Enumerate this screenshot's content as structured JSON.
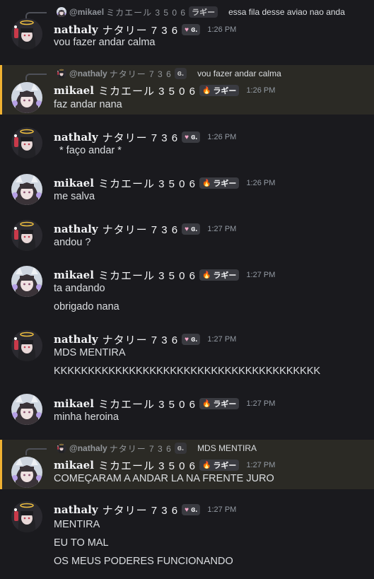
{
  "users": {
    "nathaly": {
      "name": "nathaly",
      "name_jp": "ナタリー 7 3 6",
      "tag": "ɞ.",
      "tag_icon": "♥"
    },
    "mikael": {
      "name": "mikael",
      "name_jp": "ミカエール 3 5 0 6",
      "tag": "ラギー",
      "tag_icon": "🔥"
    }
  },
  "colors": {
    "background": "#1a1a1e",
    "highlight_bg": "#2b2a25",
    "highlight_bar": "#f0b232",
    "timestamp": "#949ba4",
    "tag_bg": "#3a3b41"
  },
  "messages": [
    {
      "author": "nathaly",
      "time": "1:26 PM",
      "highlighted": false,
      "reply": {
        "author": "@mikael",
        "author_jp": "ミカエール 3 5 0 6",
        "tag": "ラギー",
        "text": "essa fila desse aviao nao anda"
      },
      "lines": [
        "vou fazer andar calma"
      ]
    },
    {
      "author": "mikael",
      "time": "1:26 PM",
      "highlighted": true,
      "reply": {
        "author": "@nathaly",
        "author_jp": "ナタリー 7 3 6",
        "tag": "ɞ.",
        "text": "vou fazer andar calma"
      },
      "lines": [
        "faz andar nana"
      ]
    },
    {
      "author": "nathaly",
      "time": "1:26 PM",
      "highlighted": false,
      "lines": [
        "  * faço andar *"
      ]
    },
    {
      "author": "mikael",
      "time": "1:26 PM",
      "highlighted": false,
      "lines": [
        "me salva"
      ]
    },
    {
      "author": "nathaly",
      "time": "1:27 PM",
      "highlighted": false,
      "lines": [
        "andou ?"
      ]
    },
    {
      "author": "mikael",
      "time": "1:27 PM",
      "highlighted": false,
      "lines": [
        "ta andando",
        "obrigado nana"
      ]
    },
    {
      "author": "nathaly",
      "time": "1:27 PM",
      "highlighted": false,
      "lines": [
        "MDS MENTIRA",
        "KKKKKKKKKKKKKKKKKKKKKKKKKKKKKKKKKKKKKKK"
      ]
    },
    {
      "author": "mikael",
      "time": "1:27 PM",
      "highlighted": false,
      "lines": [
        "minha heroina"
      ]
    },
    {
      "author": "mikael",
      "time": "1:27 PM",
      "highlighted": true,
      "reply": {
        "author": "@nathaly",
        "author_jp": "ナタリー 7 3 6",
        "tag": "ɞ.",
        "text": "MDS MENTIRA"
      },
      "lines": [
        "COMEÇARAM A ANDAR LA NA FRENTE JURO"
      ]
    },
    {
      "author": "nathaly",
      "time": "1:27 PM",
      "highlighted": false,
      "lines": [
        "MENTIRA",
        "EU TO MAL",
        "OS MEUS PODERES FUNCIONANDO"
      ]
    }
  ]
}
